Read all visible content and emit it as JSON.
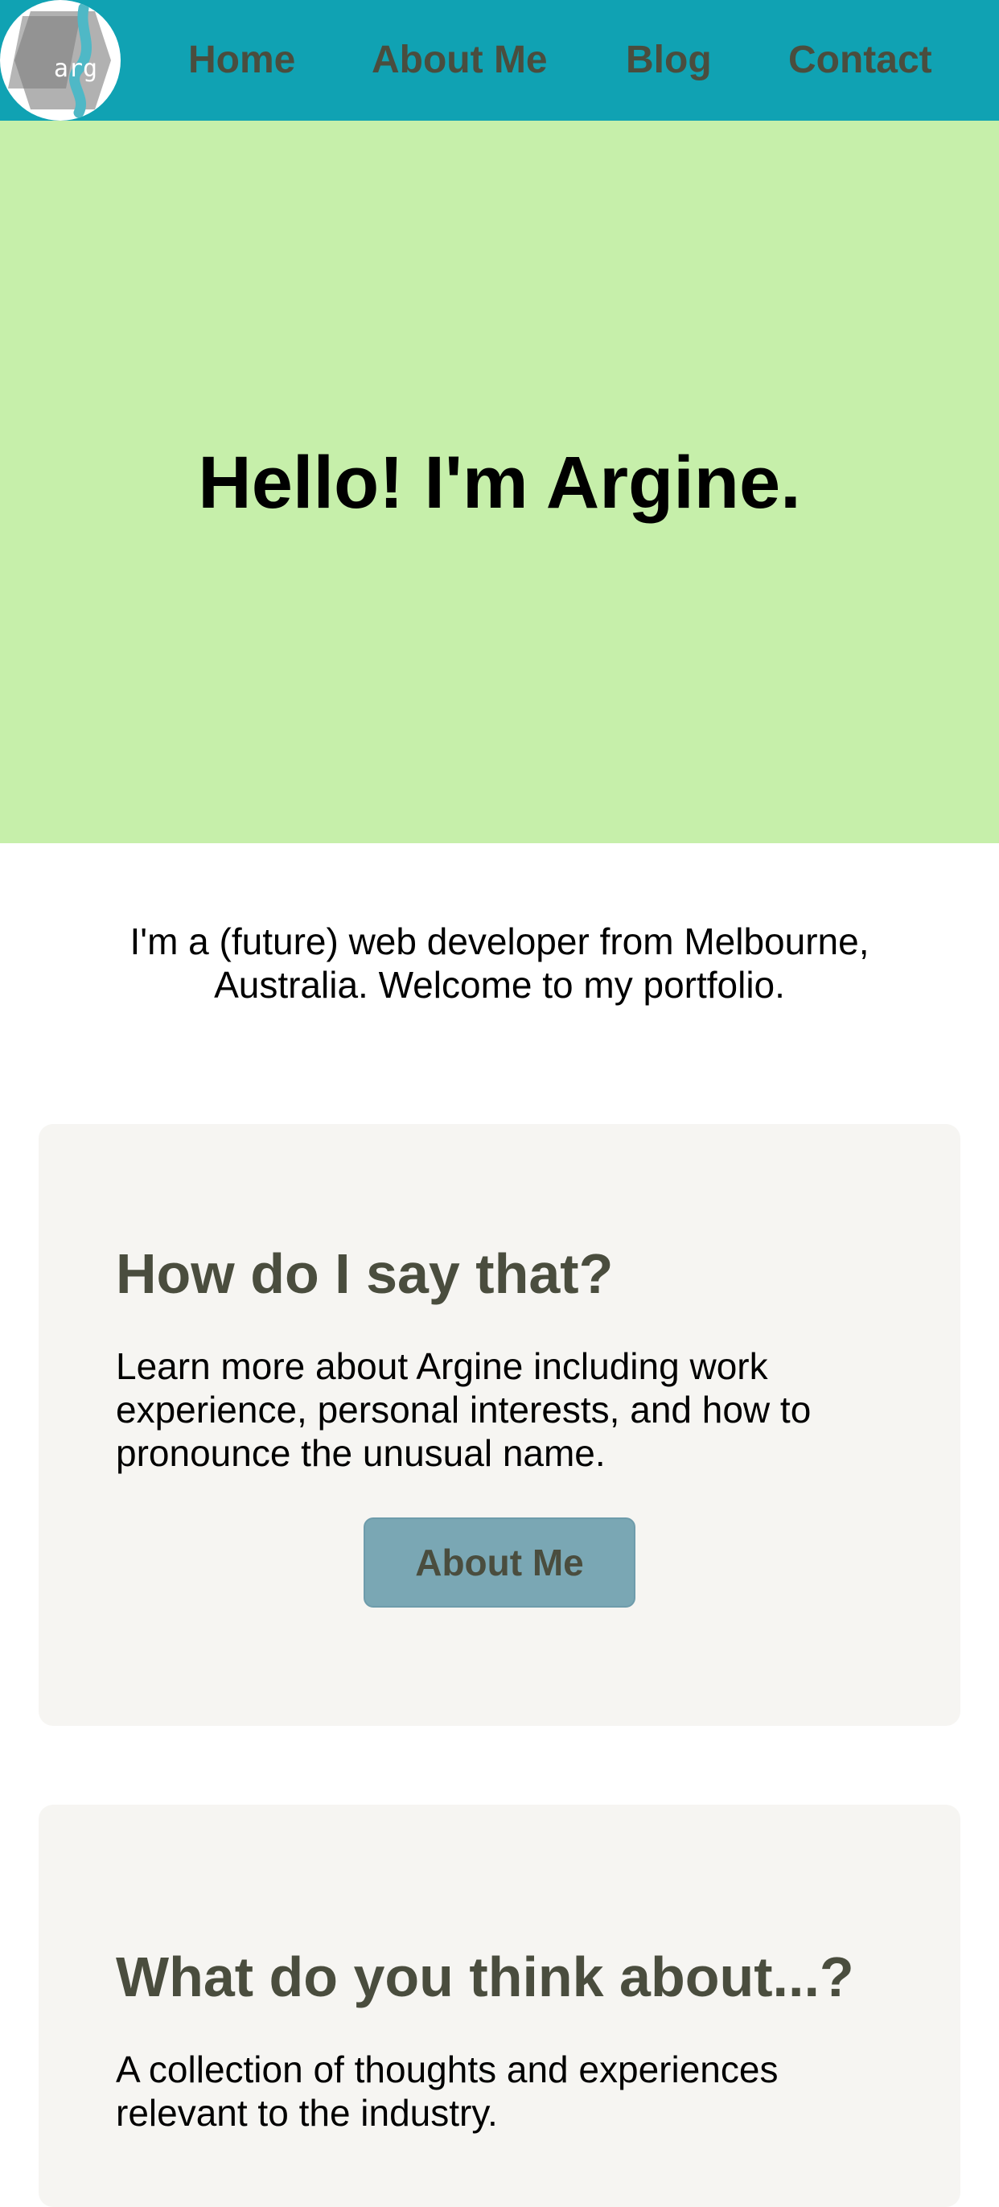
{
  "logo": {
    "text": "arg",
    "icon": "arg-logo-icon"
  },
  "nav": {
    "items": [
      {
        "label": "Home"
      },
      {
        "label": "About Me"
      },
      {
        "label": "Blog"
      },
      {
        "label": "Contact"
      }
    ]
  },
  "hero": {
    "title": "Hello! I'm Argine."
  },
  "intro": {
    "text": "I'm a (future) web developer from Melbourne, Australia. Welcome to my portfolio."
  },
  "cards": [
    {
      "title": "How do I say that?",
      "text": "Learn more about Argine including work experience, personal interests, and how to pronounce the unusual name.",
      "button_label": "About Me"
    },
    {
      "title": "What do you think about...?",
      "text": "A collection of thoughts and experiences relevant to the industry."
    }
  ],
  "colors": {
    "navbar": "#10a2b3",
    "hero_background": "#c6efaa",
    "card_background": "#f6f5f2",
    "heading_text": "#4a4d3e",
    "button_background": "#7aa7b4"
  }
}
